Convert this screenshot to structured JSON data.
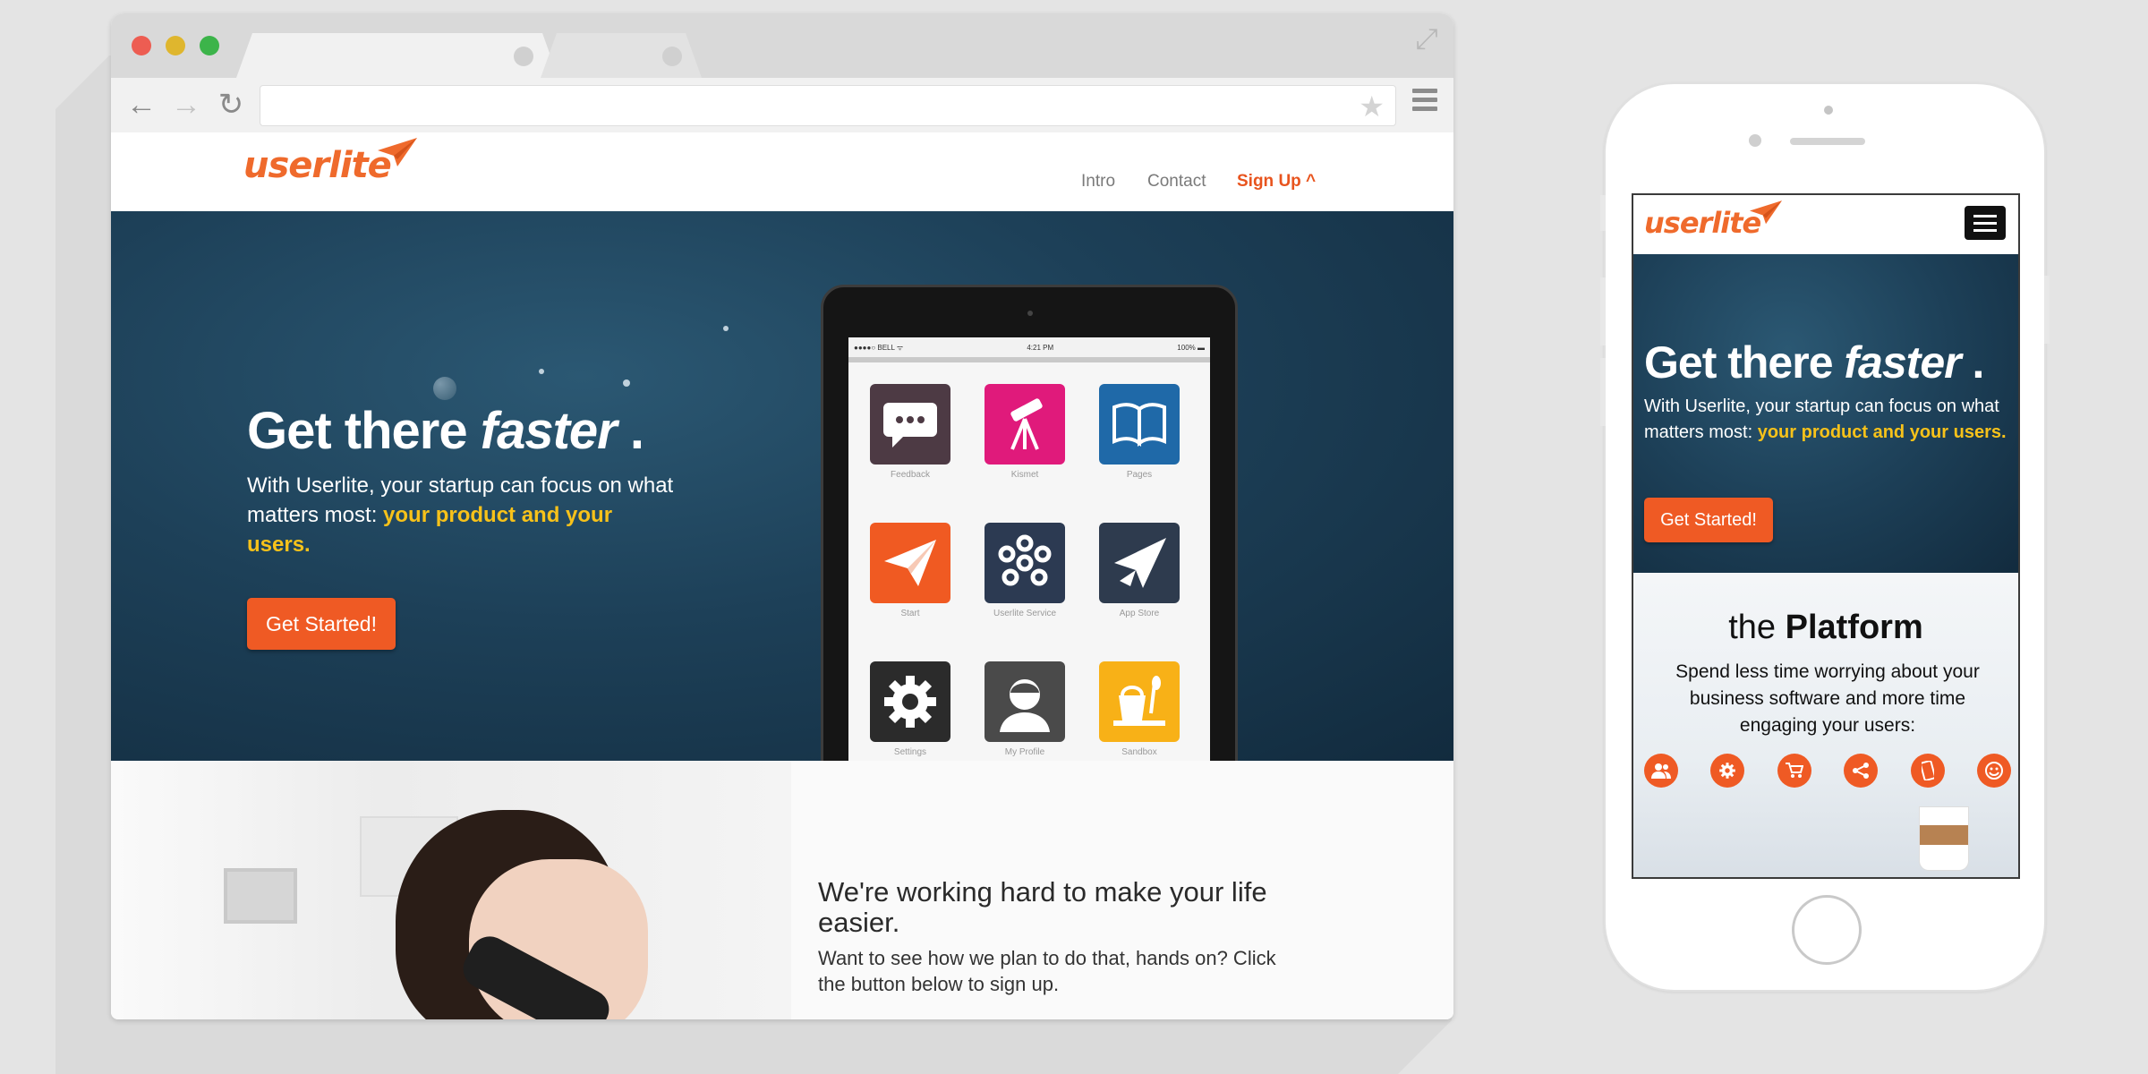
{
  "browser": {
    "logo": "userlite",
    "nav": {
      "intro": "Intro",
      "contact": "Contact",
      "signup": "Sign Up ^"
    },
    "hero": {
      "title_plain": "Get there ",
      "title_em": "faster",
      "title_end": " .",
      "sub_plain": "With Userlite, your startup can focus on what matters most: ",
      "sub_highlight": "your product and your users.",
      "cta": "Get Started!"
    },
    "tablet": {
      "status_left": "●●●●○ BELL ᯤ",
      "status_center": "4:21 PM",
      "status_right": "100% ▬",
      "apps": [
        {
          "label": "Feedback",
          "icon": "chat-bubble-icon",
          "color": "#4d3a44"
        },
        {
          "label": "Kismet",
          "icon": "telescope-icon",
          "color": "#e01a7b"
        },
        {
          "label": "Pages",
          "icon": "book-icon",
          "color": "#1f69a8"
        },
        {
          "label": "Start",
          "icon": "paper-plane-icon",
          "color": "#f05a22"
        },
        {
          "label": "Userlite Service",
          "icon": "network-nodes-icon",
          "color": "#2c3a52"
        },
        {
          "label": "App Store",
          "icon": "rocket-plane-icon",
          "color": "#2e3b4e"
        },
        {
          "label": "Settings",
          "icon": "gear-icon",
          "color": "#2b2b2b"
        },
        {
          "label": "My Profile",
          "icon": "person-icon",
          "color": "#4a4a4a"
        },
        {
          "label": "Sandbox",
          "icon": "bucket-shovel-icon",
          "color": "#f8b117"
        }
      ]
    },
    "section2": {
      "title": "We're working hard to make your life easier.",
      "sub": "Want to see how we plan to do that, hands on? Click the button below to sign up."
    }
  },
  "mobile": {
    "logo": "userlite",
    "hero": {
      "title_plain": "Get there ",
      "title_em": "faster",
      "title_end": " .",
      "sub_plain": "With Userlite, your startup can focus on what matters most: ",
      "sub_highlight": "your product and your users.",
      "cta": "Get Started!"
    },
    "platform": {
      "title_plain": "the ",
      "title_bold": "Platform",
      "sub": "Spend less time worrying about your business software and more time engaging your users:",
      "icons": [
        "users-icon",
        "gear-icon",
        "cart-icon",
        "share-icon",
        "mobile-icon",
        "smiley-icon"
      ]
    }
  },
  "colors": {
    "brand_orange": "#ef5a24",
    "highlight_yellow": "#f7c21a",
    "hero_blue": "#1d4058"
  }
}
